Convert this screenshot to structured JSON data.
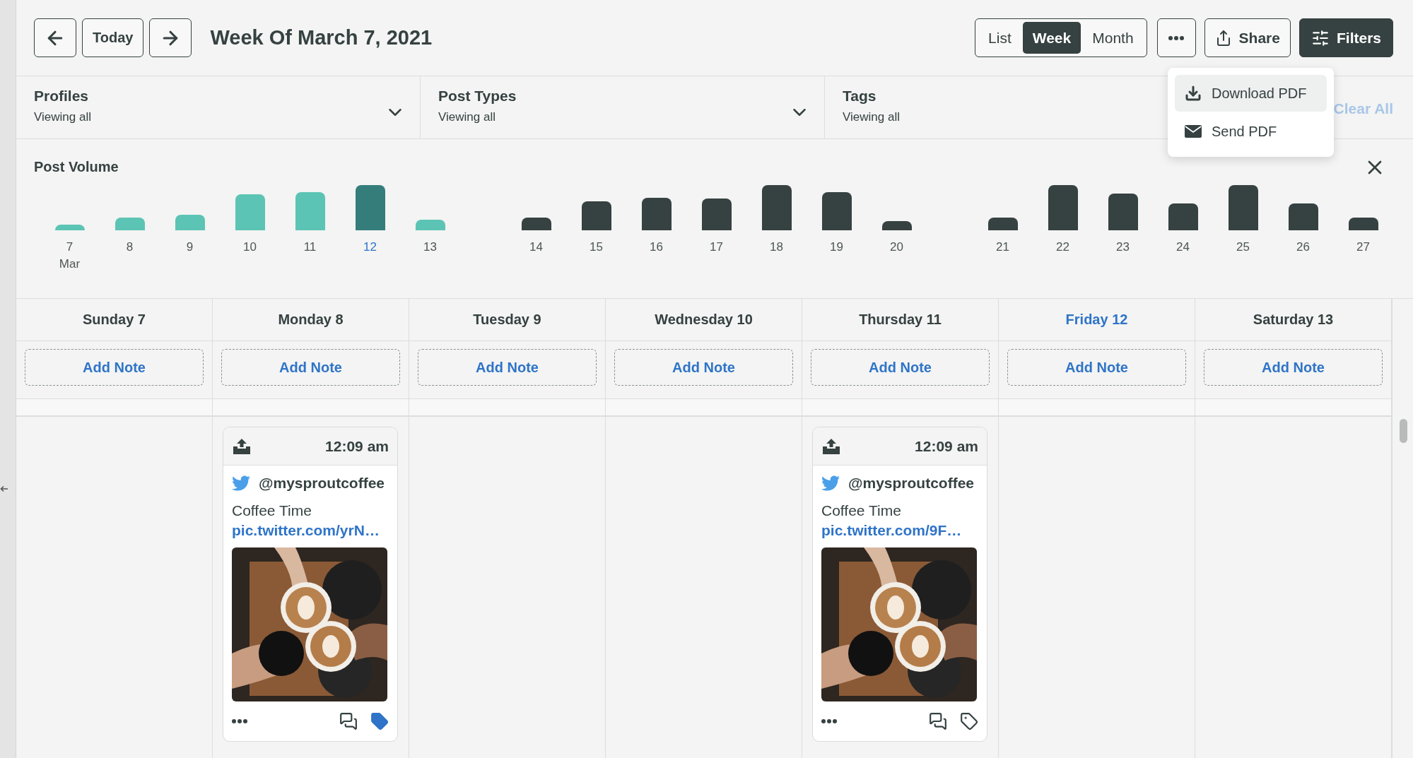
{
  "toolbar": {
    "today_button": "Today",
    "title": "Week Of March 7, 2021",
    "view_tabs": [
      {
        "label": "List",
        "selected": false
      },
      {
        "label": "Week",
        "selected": true
      },
      {
        "label": "Month",
        "selected": false
      }
    ],
    "share_button": "Share",
    "filters_button": "Filters"
  },
  "filters": [
    {
      "label": "Profiles",
      "value": "Viewing all"
    },
    {
      "label": "Post Types",
      "value": "Viewing all"
    },
    {
      "label": "Tags",
      "value": "Viewing all"
    }
  ],
  "clear_all": "Clear All",
  "menu": [
    {
      "kind": "download",
      "label": "Download PDF",
      "selected": true
    },
    {
      "kind": "send",
      "label": "Send PDF",
      "selected": false
    }
  ],
  "post_volume": {
    "title": "Post Volume",
    "weeks": [
      [
        {
          "label": "7",
          "sublabel": "Mar",
          "in_view": true,
          "selected": false
        },
        {
          "label": "8",
          "in_view": true,
          "selected": false
        },
        {
          "label": "9",
          "in_view": true,
          "selected": false
        },
        {
          "label": "10",
          "in_view": true,
          "selected": false
        },
        {
          "label": "11",
          "in_view": true,
          "selected": false
        },
        {
          "label": "12",
          "in_view": true,
          "selected": true
        },
        {
          "label": "13",
          "in_view": true,
          "selected": false
        }
      ],
      [
        {
          "label": "14",
          "in_view": false,
          "selected": false
        },
        {
          "label": "15",
          "in_view": false,
          "selected": false
        },
        {
          "label": "16",
          "in_view": false,
          "selected": false
        },
        {
          "label": "17",
          "in_view": false,
          "selected": false
        },
        {
          "label": "18",
          "in_view": false,
          "selected": false
        },
        {
          "label": "19",
          "in_view": false,
          "selected": false
        },
        {
          "label": "20",
          "in_view": false,
          "selected": false
        }
      ],
      [
        {
          "label": "21",
          "in_view": false,
          "selected": false
        },
        {
          "label": "22",
          "in_view": false,
          "selected": false
        },
        {
          "label": "23",
          "in_view": false,
          "selected": false
        },
        {
          "label": "24",
          "in_view": false,
          "selected": false
        },
        {
          "label": "25",
          "in_view": false,
          "selected": false
        },
        {
          "label": "26",
          "in_view": false,
          "selected": false
        },
        {
          "label": "27",
          "in_view": false,
          "selected": false
        }
      ]
    ]
  },
  "calendar": {
    "days": [
      {
        "label": "Sunday 7",
        "today": false,
        "note_button": "Add Note"
      },
      {
        "label": "Monday 8",
        "today": false,
        "note_button": "Add Note",
        "posts": [
          {
            "time": "12:09 am",
            "handle": "@mysproutcoffee",
            "text": "Coffee Time",
            "link": "pic.twitter.com/yrN…",
            "tagged": true
          }
        ]
      },
      {
        "label": "Tuesday 9",
        "today": false,
        "note_button": "Add Note"
      },
      {
        "label": "Wednesday 10",
        "today": false,
        "note_button": "Add Note"
      },
      {
        "label": "Thursday 11",
        "today": false,
        "note_button": "Add Note",
        "posts": [
          {
            "time": "12:09 am",
            "handle": "@mysproutcoffee",
            "text": "Coffee Time",
            "link": "pic.twitter.com/9F…",
            "tagged": false
          }
        ]
      },
      {
        "label": "Friday 12",
        "today": true,
        "note_button": "Add Note"
      },
      {
        "label": "Saturday 13",
        "today": false,
        "note_button": "Add Note"
      }
    ]
  }
}
